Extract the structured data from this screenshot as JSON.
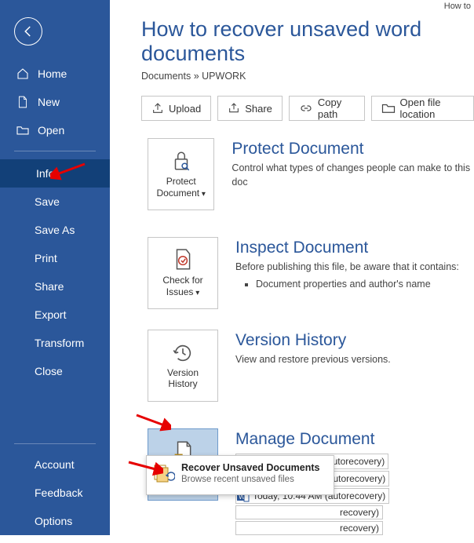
{
  "top_small": "How to",
  "title": "How to recover unsaved word documents",
  "breadcrumb": {
    "root": "Documents",
    "sep": "»",
    "folder": "UPWORK"
  },
  "sidebar": {
    "home": "Home",
    "new": "New",
    "open": "Open",
    "info": "Info",
    "save": "Save",
    "save_as": "Save As",
    "print": "Print",
    "share": "Share",
    "export": "Export",
    "transform": "Transform",
    "close": "Close",
    "account": "Account",
    "feedback": "Feedback",
    "options": "Options"
  },
  "toolbar": {
    "upload": "Upload",
    "share": "Share",
    "copy_path": "Copy path",
    "open_loc": "Open file location"
  },
  "sections": {
    "protect": {
      "title": "Protect Document",
      "desc": "Control what types of changes people can make to this doc",
      "tile": "Protect Document"
    },
    "inspect": {
      "title": "Inspect Document",
      "desc": "Before publishing this file, be aware that it contains:",
      "bullet1": "Document properties and author's name",
      "tile": "Check for Issues"
    },
    "history": {
      "title": "Version History",
      "desc": "View and restore previous versions.",
      "tile": "Version History"
    },
    "manage": {
      "title": "Manage Document",
      "tile": "Manage Document"
    }
  },
  "versions": [
    "Today, 11:05 AM (autorecovery)",
    "Today, 10:55 AM (autorecovery)",
    "Today, 10:44 AM (autorecovery)",
    "recovery)",
    "recovery)"
  ],
  "popup": {
    "title": "Recover Unsaved Documents",
    "sub": "Browse recent unsaved files"
  }
}
